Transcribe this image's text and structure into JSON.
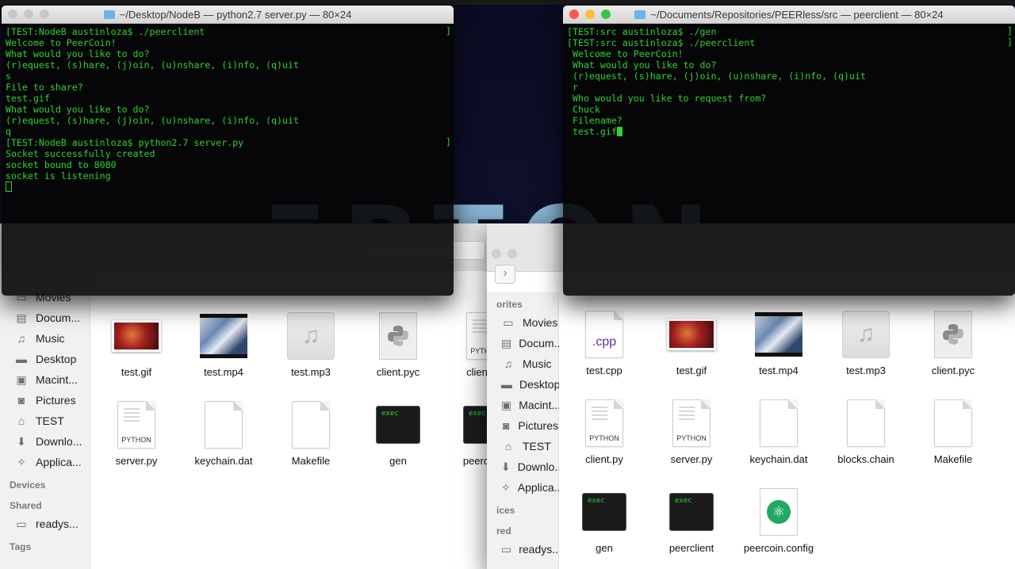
{
  "finder_left": {
    "sidebar": [
      {
        "type": "item",
        "icon": "film-icon",
        "label": "Movies"
      },
      {
        "type": "item",
        "icon": "document-icon",
        "label": "Docum..."
      },
      {
        "type": "item",
        "icon": "music-note-icon",
        "label": "Music"
      },
      {
        "type": "item",
        "icon": "desktop-icon",
        "label": "Desktop"
      },
      {
        "type": "item",
        "icon": "harddrive-icon",
        "label": "Macint..."
      },
      {
        "type": "item",
        "icon": "camera-icon",
        "label": "Pictures"
      },
      {
        "type": "item",
        "icon": "home-icon",
        "label": "TEST"
      },
      {
        "type": "item",
        "icon": "download-icon",
        "label": "Downlo..."
      },
      {
        "type": "item",
        "icon": "applications-icon",
        "label": "Applica..."
      },
      {
        "type": "section",
        "label": "Devices"
      },
      {
        "type": "section",
        "label": "Shared"
      },
      {
        "type": "item",
        "icon": "monitor-icon",
        "label": "readys..."
      },
      {
        "type": "section",
        "label": "Tags"
      }
    ],
    "files": [
      {
        "name": "test.gif",
        "kind": "image"
      },
      {
        "name": "test.mp4",
        "kind": "video"
      },
      {
        "name": "test.mp3",
        "kind": "audio"
      },
      {
        "name": "client.pyc",
        "kind": "pyc"
      },
      {
        "name": "client.py",
        "kind": "python",
        "tag": "PYTHON"
      },
      {
        "name": "server.py",
        "kind": "python",
        "tag": "PYTHON"
      },
      {
        "name": "keychain.dat",
        "kind": "blank"
      },
      {
        "name": "Makefile",
        "kind": "blank"
      },
      {
        "name": "gen",
        "kind": "exec",
        "tag": "exec"
      },
      {
        "name": "peerclient",
        "kind": "exec",
        "tag": "exec"
      }
    ]
  },
  "finder_right": {
    "sidebar": [
      {
        "type": "section",
        "label": "orites"
      },
      {
        "type": "item",
        "icon": "film-icon",
        "label": "Movies"
      },
      {
        "type": "item",
        "icon": "document-icon",
        "label": "Docum..."
      },
      {
        "type": "item",
        "icon": "music-note-icon",
        "label": "Music"
      },
      {
        "type": "item",
        "icon": "desktop-icon",
        "label": "Desktop"
      },
      {
        "type": "item",
        "icon": "harddrive-icon",
        "label": "Macint..."
      },
      {
        "type": "item",
        "icon": "camera-icon",
        "label": "Pictures"
      },
      {
        "type": "item",
        "icon": "home-icon",
        "label": "TEST"
      },
      {
        "type": "item",
        "icon": "download-icon",
        "label": "Downlo..."
      },
      {
        "type": "item",
        "icon": "applications-icon",
        "label": "Applica..."
      },
      {
        "type": "section",
        "label": "ices"
      },
      {
        "type": "section",
        "label": "red"
      },
      {
        "type": "item",
        "icon": "monitor-icon",
        "label": "readys..."
      }
    ],
    "files": [
      {
        "name": "test.cpp",
        "kind": "cpp",
        "tag": ".cpp"
      },
      {
        "name": "test.gif",
        "kind": "image"
      },
      {
        "name": "test.mp4",
        "kind": "video"
      },
      {
        "name": "test.mp3",
        "kind": "audio"
      },
      {
        "name": "client.pyc",
        "kind": "pyc"
      },
      {
        "name": "client.py",
        "kind": "python",
        "tag": "PYTHON"
      },
      {
        "name": "server.py",
        "kind": "python",
        "tag": "PYTHON"
      },
      {
        "name": "keychain.dat",
        "kind": "blank"
      },
      {
        "name": "blocks.chain",
        "kind": "blank"
      },
      {
        "name": "Makefile",
        "kind": "blank"
      },
      {
        "name": "gen",
        "kind": "exec",
        "tag": "exec"
      },
      {
        "name": "peerclient",
        "kind": "exec",
        "tag": "exec"
      },
      {
        "name": "peercoin.config",
        "kind": "atom"
      }
    ]
  },
  "terminal_left": {
    "title": "~/Desktop/NodeB — python2.7 server.py — 80×24",
    "lines": [
      "[TEST:NodeB austinloza$ ./peerclient",
      "Welcome to PeerCoin!",
      "What would you like to do?",
      "(r)equest, (s)hare, (j)oin, (u)nshare, (i)nfo, (q)uit",
      "s",
      "File to share?",
      "test.gif",
      "What would you like to do?",
      "(r)equest, (s)hare, (j)oin, (u)nshare, (i)nfo, (q)uit",
      "q",
      "[TEST:NodeB austinloza$ python2.7 server.py",
      "Socket successfully created",
      "socket bound to 8080",
      "socket is listening"
    ]
  },
  "terminal_right": {
    "title": "~/Documents/Repositories/PEERless/src — peerclient — 80×24",
    "lines": [
      "[TEST:src austinloza$ ./gen",
      "[TEST:src austinloza$ ./peerclient",
      " Welcome to PeerCoin!",
      " What would you like to do?",
      " (r)equest, (s)hare, (j)oin, (u)nshare, (i)nfo, (q)uit",
      " r",
      " Who would you like to request from?",
      " Chuck",
      " Filename?",
      " test.gif"
    ]
  },
  "colors": {
    "terminal_text": "#2fd32f",
    "close": "#fc5753",
    "minimize": "#fdbc40",
    "zoom": "#33c748"
  }
}
